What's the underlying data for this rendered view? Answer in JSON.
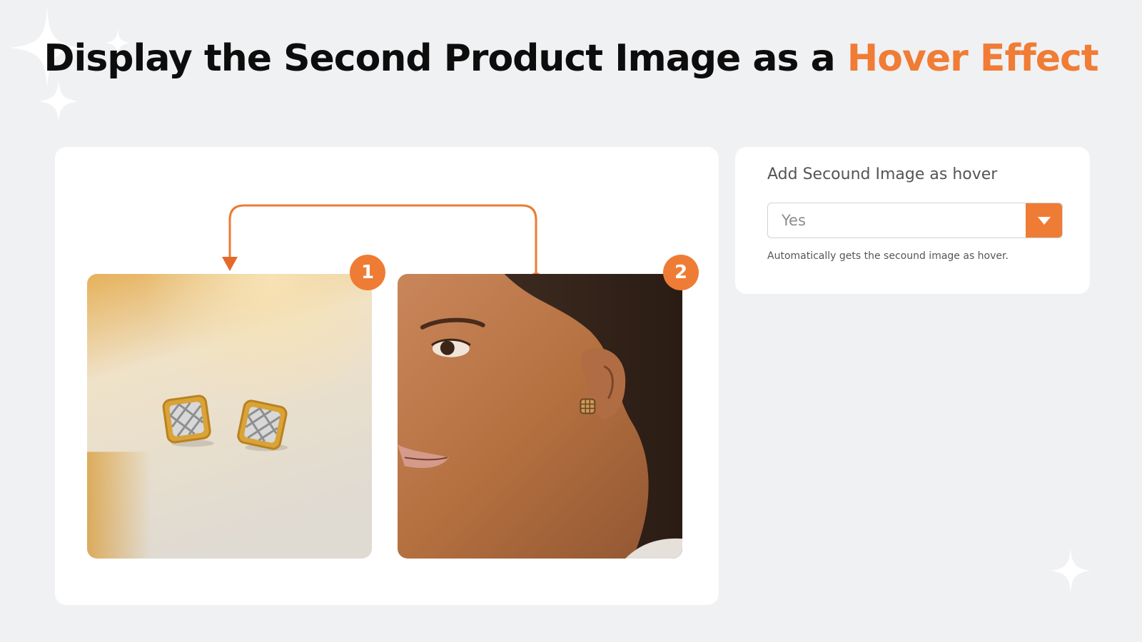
{
  "header": {
    "title_main": "Display the Second Product Image as a ",
    "title_accent": "Hover Effect"
  },
  "preview": {
    "images": [
      {
        "badge": "1",
        "subject": "earrings-product-photo"
      },
      {
        "badge": "2",
        "subject": "model-wearing-earring-photo"
      }
    ]
  },
  "setting": {
    "label": "Add Secound Image as hover",
    "selected_value": "Yes",
    "help_text": "Automatically gets the secound image as hover."
  },
  "colors": {
    "accent": "#ef7c34",
    "background": "#f0f1f3",
    "card": "#ffffff",
    "title": "#0d0d0d"
  }
}
